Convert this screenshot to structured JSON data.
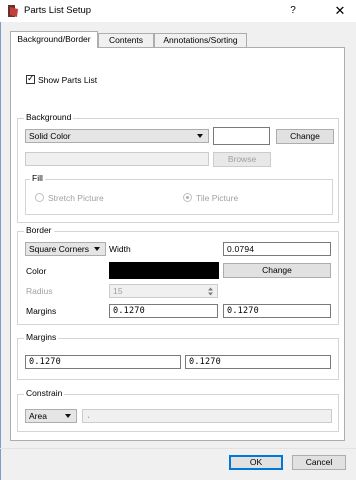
{
  "window": {
    "title": "Parts List Setup",
    "help": "?",
    "close": "✕"
  },
  "tabs": [
    {
      "label": "Background/Border",
      "active": true
    },
    {
      "label": "Contents",
      "active": false
    },
    {
      "label": "Annotations/Sorting",
      "active": false
    }
  ],
  "show_parts_list": {
    "label": "Show Parts List",
    "checked": true,
    "mark": "✓"
  },
  "background": {
    "group_label": "Background",
    "type_value": "Solid Color",
    "change_label": "Change",
    "browse_label": "Browse",
    "fill_label": "Fill",
    "stretch_label": "Stretch Picture",
    "tile_label": "Tile Picture"
  },
  "border": {
    "group_label": "Border",
    "corner_value": "Square Corners",
    "width_label": "Width",
    "width_value": "0.0794",
    "color_label": "Color",
    "color_value": "#000000",
    "change_label": "Change",
    "radius_label": "Radius",
    "radius_value": "15",
    "margins_label": "Margins",
    "margin_1": "0.1270",
    "margin_2": "0.1270"
  },
  "margins": {
    "group_label": "Margins",
    "margin_1": "0.1270",
    "margin_2": "0.1270"
  },
  "constrain": {
    "group_label": "Constrain",
    "type_value": "Area",
    "field_value": "."
  },
  "footer": {
    "ok_label": "OK",
    "cancel_label": "Cancel"
  }
}
